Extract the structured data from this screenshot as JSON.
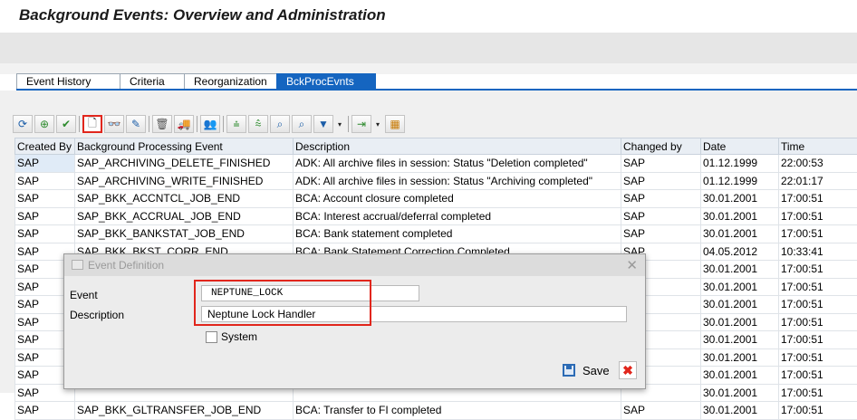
{
  "window": {
    "title": "Background Events: Overview and Administration"
  },
  "tabs": [
    {
      "label": "Event History"
    },
    {
      "label": "Criteria"
    },
    {
      "label": "Reorganization"
    },
    {
      "label": "BckProcEvnts",
      "active": true
    }
  ],
  "toolbar": {
    "icons": [
      "refresh-icon",
      "check-icon",
      "check-all-icon",
      "create-icon",
      "display-icon",
      "edit-icon",
      "delete-icon",
      "transport-icon",
      "where-used-icon",
      "sort-ascending-icon",
      "sort-descending-icon",
      "find-icon",
      "find-next-icon",
      "filter-icon",
      "export-icon",
      "layout-icon"
    ]
  },
  "table": {
    "columns": [
      "Created By",
      "Background Processing Event",
      "Description",
      "Changed by",
      "Date",
      "Time"
    ],
    "rows": [
      [
        "SAP",
        "SAP_ARCHIVING_DELETE_FINISHED",
        "ADK: All archive files in session: Status \"Deletion completed\"",
        "SAP",
        "01.12.1999",
        "22:00:53"
      ],
      [
        "SAP",
        "SAP_ARCHIVING_WRITE_FINISHED",
        "ADK: All archive files in session: Status \"Archiving completed\"",
        "SAP",
        "01.12.1999",
        "22:01:17"
      ],
      [
        "SAP",
        "SAP_BKK_ACCNTCL_JOB_END",
        "BCA: Account closure completed",
        "SAP",
        "30.01.2001",
        "17:00:51"
      ],
      [
        "SAP",
        "SAP_BKK_ACCRUAL_JOB_END",
        "BCA: Interest accrual/deferral completed",
        "SAP",
        "30.01.2001",
        "17:00:51"
      ],
      [
        "SAP",
        "SAP_BKK_BANKSTAT_JOB_END",
        "BCA: Bank statement completed",
        "SAP",
        "30.01.2001",
        "17:00:51"
      ],
      [
        "SAP",
        "SAP_BKK_BKST_CORR_END",
        "BCA: Bank Statement Correction Completed",
        "SAP",
        "04.05.2012",
        "10:33:41"
      ],
      [
        "SAP",
        "",
        "",
        "",
        "30.01.2001",
        "17:00:51"
      ],
      [
        "SAP",
        "",
        "",
        "",
        "30.01.2001",
        "17:00:51"
      ],
      [
        "SAP",
        "",
        "",
        "",
        "30.01.2001",
        "17:00:51"
      ],
      [
        "SAP",
        "",
        "",
        "",
        "30.01.2001",
        "17:00:51"
      ],
      [
        "SAP",
        "",
        "",
        "",
        "30.01.2001",
        "17:00:51"
      ],
      [
        "SAP",
        "",
        "",
        "",
        "30.01.2001",
        "17:00:51"
      ],
      [
        "SAP",
        "",
        "",
        "",
        "30.01.2001",
        "17:00:51"
      ],
      [
        "SAP",
        "",
        "",
        "",
        "30.01.2001",
        "17:00:51"
      ],
      [
        "SAP",
        "SAP_BKK_GLTRANSFER_JOB_END",
        "BCA: Transfer to FI completed",
        "SAP",
        "30.01.2001",
        "17:00:51"
      ]
    ]
  },
  "dialog": {
    "title": "Event Definition",
    "event_label": "Event",
    "event_value": "NEPTUNE_LOCK",
    "description_label": "Description",
    "description_value": "Neptune Lock Handler",
    "system_label": "System",
    "save_label": "Save"
  },
  "colors": {
    "accent": "#1565c0",
    "highlight": "#e1261c"
  }
}
